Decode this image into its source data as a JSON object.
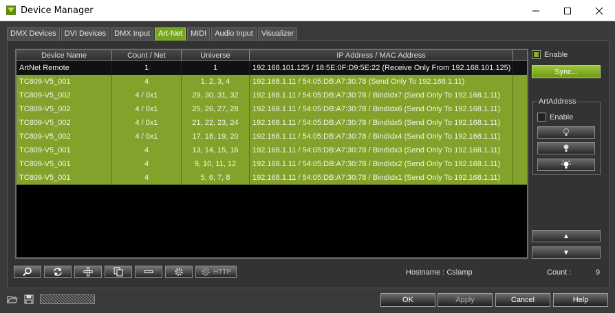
{
  "window": {
    "title": "Device Manager",
    "accent_color": "#87b226",
    "selected_row_color": "#83a22b"
  },
  "tabs": [
    {
      "label": "DMX Devices",
      "active": false
    },
    {
      "label": "DVI Devices",
      "active": false
    },
    {
      "label": "DMX Input",
      "active": false
    },
    {
      "label": "Art-Net",
      "active": true
    },
    {
      "label": "MIDI",
      "active": false
    },
    {
      "label": "Audio Input",
      "active": false
    },
    {
      "label": "Visualizer",
      "active": false
    }
  ],
  "table": {
    "headers": [
      "Device Name",
      "Count / Net",
      "Universe",
      "IP Address / MAC Address"
    ],
    "rows": [
      {
        "name": "ArtNet Remote",
        "count": "1",
        "universe": "1",
        "address": "192.168.101.125 / 18:5E:0F:D9:5E:22 (Receive Only From 192.168.101.125)",
        "selected": false
      },
      {
        "name": "TC809-V5_001",
        "count": "4",
        "universe": "1, 2, 3, 4",
        "address": "192.168.1.11 / 54:05:DB:A7:30:78 (Send Only To 192.168.1.11)",
        "selected": true
      },
      {
        "name": "TC809-V5_002",
        "count": "4 / 0x1",
        "universe": "29, 30, 31, 32",
        "address": "192.168.1.11 / 54:05:DB:A7:30:78 / BindIdx7 (Send Only To 192.168.1.11)",
        "selected": true
      },
      {
        "name": "TC809-V5_002",
        "count": "4 / 0x1",
        "universe": "25, 26, 27, 28",
        "address": "192.168.1.11 / 54:05:DB:A7:30:78 / BindIdx6 (Send Only To 192.168.1.11)",
        "selected": true
      },
      {
        "name": "TC809-V5_002",
        "count": "4 / 0x1",
        "universe": "21, 22, 23, 24",
        "address": "192.168.1.11 / 54:05:DB:A7:30:78 / BindIdx5 (Send Only To 192.168.1.11)",
        "selected": true
      },
      {
        "name": "TC809-V5_002",
        "count": "4 / 0x1",
        "universe": "17, 18, 19, 20",
        "address": "192.168.1.11 / 54:05:DB:A7:30:78 / BindIdx4 (Send Only To 192.168.1.11)",
        "selected": true
      },
      {
        "name": "TC809-V5_001",
        "count": "4",
        "universe": "13, 14, 15, 16",
        "address": "192.168.1.11 / 54:05:DB:A7:30:78 / BindIdx3 (Send Only To 192.168.1.11)",
        "selected": true
      },
      {
        "name": "TC809-V5_001",
        "count": "4",
        "universe": "9, 10, 11, 12",
        "address": "192.168.1.11 / 54:05:DB:A7:30:78 / BindIdx2 (Send Only To 192.168.1.11)",
        "selected": true
      },
      {
        "name": "TC809-V5_001",
        "count": "4",
        "universe": "5, 6, 7, 8",
        "address": "192.168.1.11 / 54:05:DB:A7:30:78 / BindIdx1 (Send Only To 192.168.1.11)",
        "selected": true
      }
    ]
  },
  "side": {
    "enable_label": "Enable",
    "enable_checked": true,
    "sync_label": "Sync...",
    "artaddress_title": "ArtAddress",
    "artaddress_enable_label": "Enable",
    "artaddress_enable_checked": false,
    "bulb_buttons": [
      "bulb-off-icon",
      "bulb-on-icon",
      "bulb-bright-icon"
    ],
    "up_label": "▲",
    "down_label": "▼"
  },
  "toolbar": {
    "icons": [
      "search-icon",
      "refresh-icon",
      "add-icon",
      "copy-icon",
      "remove-icon",
      "settings-icon"
    ],
    "http_label": "HTTP"
  },
  "status": {
    "hostname_label": "Hostname :",
    "hostname_value": "Cslamp",
    "count_label": "Count :",
    "count_value": "9"
  },
  "footer": {
    "ok_label": "OK",
    "apply_label": "Apply",
    "cancel_label": "Cancel",
    "help_label": "Help"
  }
}
